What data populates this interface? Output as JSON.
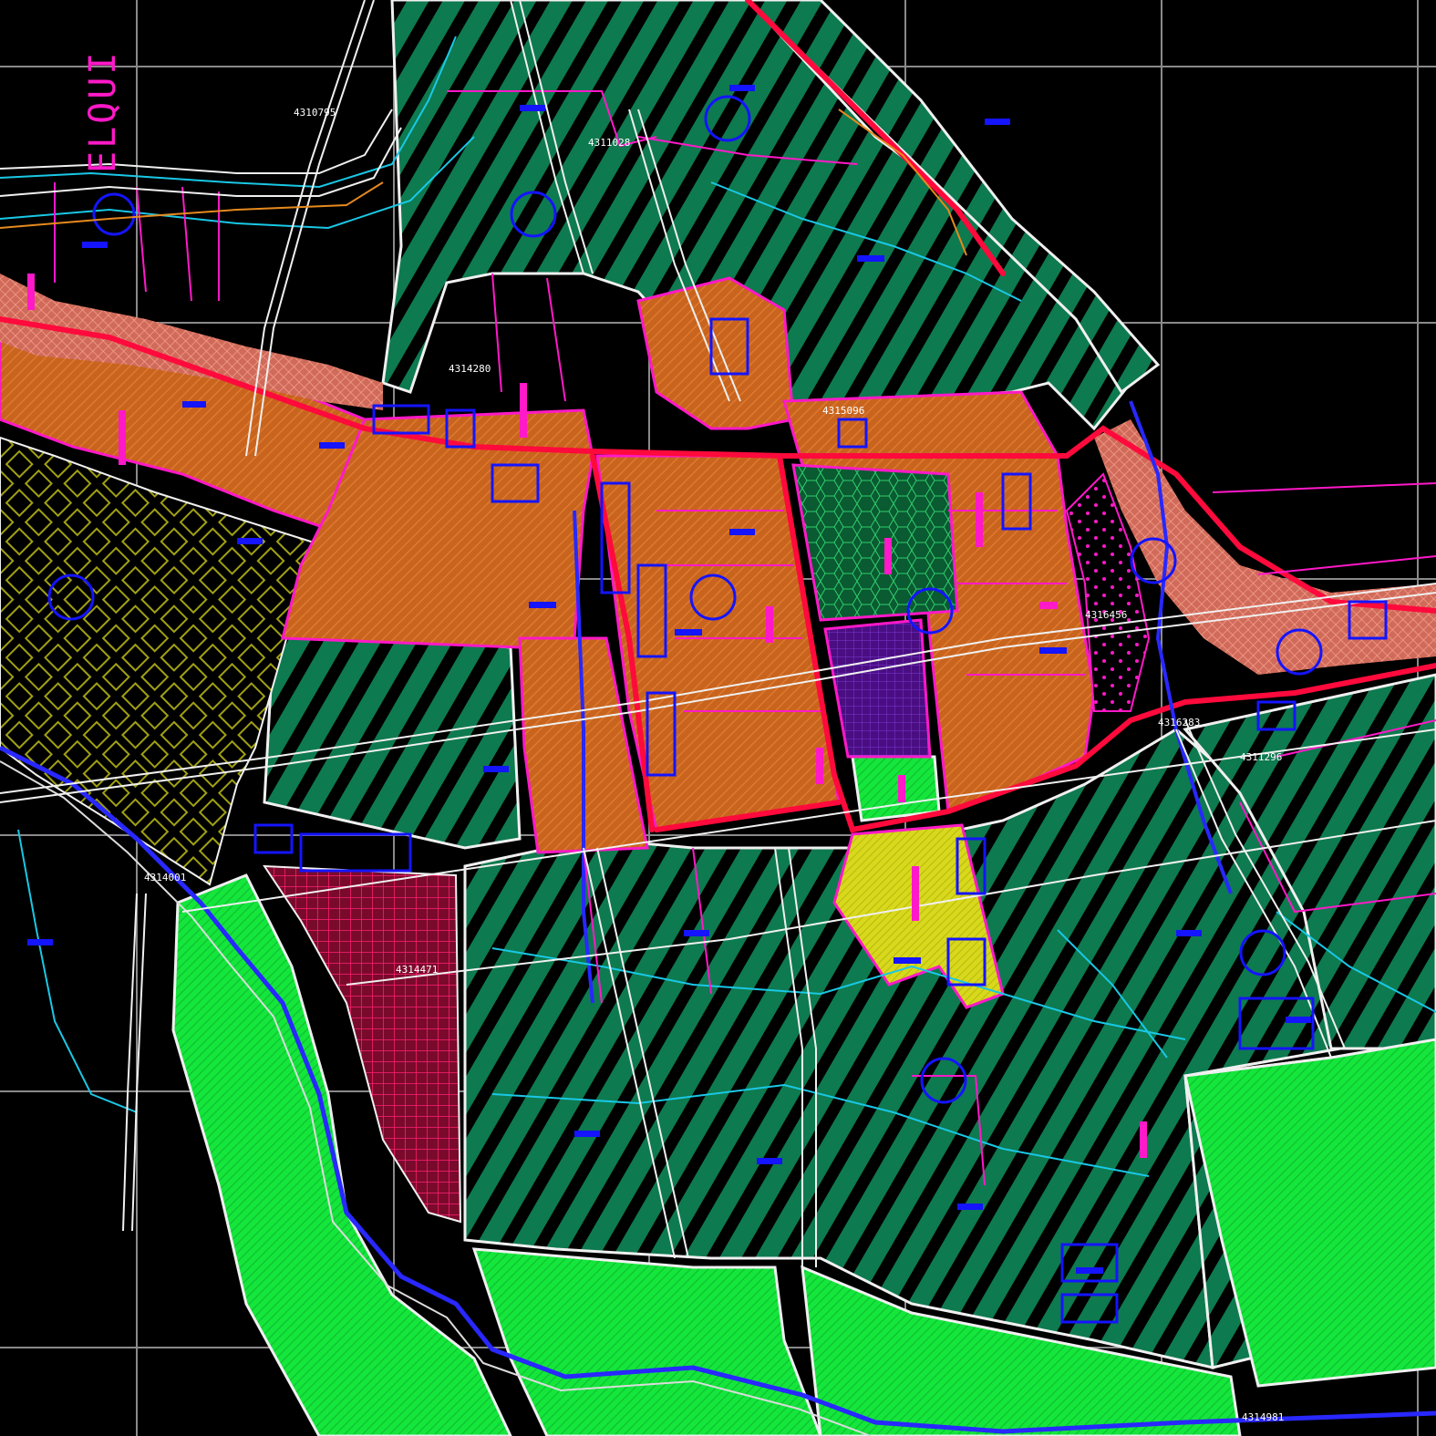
{
  "map": {
    "title_fragment": "ELQUI",
    "colors": {
      "background": "#000000",
      "grid": "#8a8a8a",
      "residential_orange": "#c8641e",
      "agricultural_hatch_green": "#0e7a4f",
      "green_area": "#12e83c",
      "road_red": "#ff0a3c",
      "lot_magenta": "#ff19c8",
      "contour_cyan": "#19c8e6",
      "building_blue": "#1414ff",
      "equipment_yellow": "#dcdc1e",
      "institutional_purple": "#5a1490",
      "crosshatch_crimson": "#8c0a32",
      "riverbed_salmon": "#e6826e",
      "olive_diamond": "#a0a014"
    },
    "coordinate_labels": [
      "4310795",
      "4311028",
      "4314280",
      "4315096",
      "4316456",
      "4316283",
      "4311296",
      "4314001",
      "4314471",
      "4314981"
    ]
  }
}
